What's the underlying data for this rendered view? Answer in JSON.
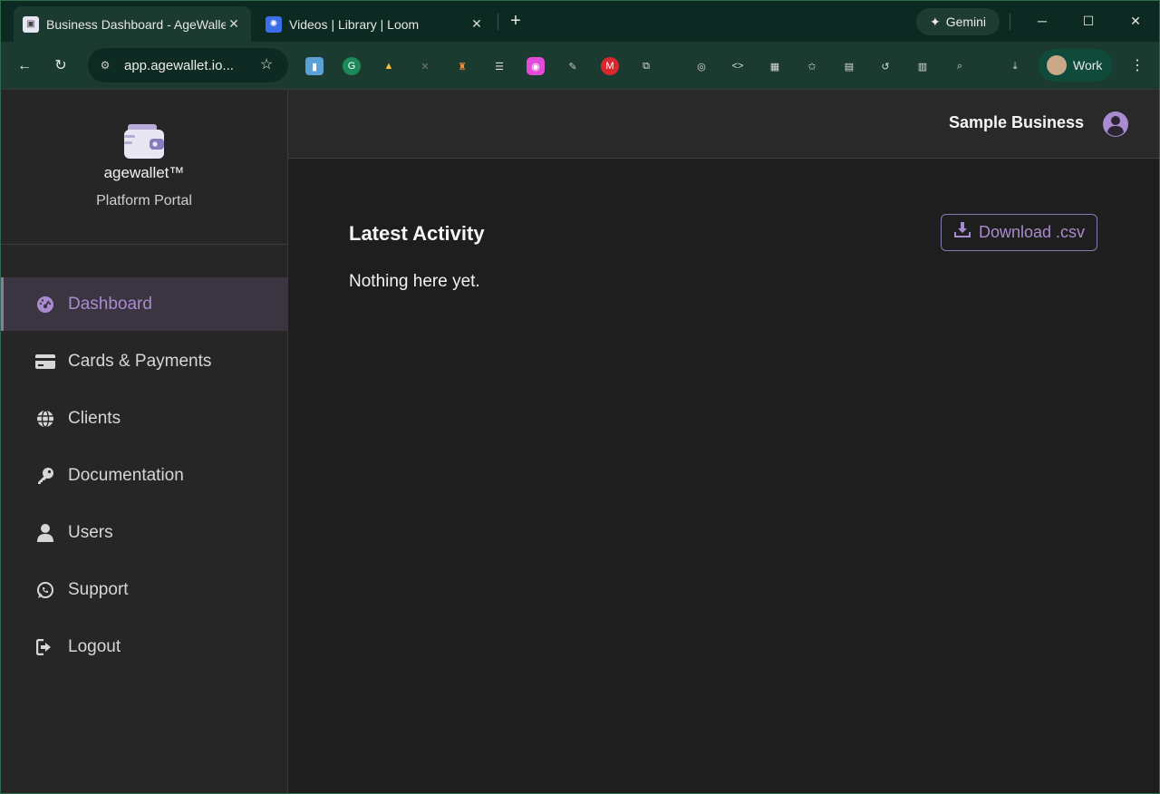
{
  "browser": {
    "tabs": [
      {
        "title": "Business Dashboard - AgeWallet",
        "active": true
      },
      {
        "title": "Videos | Library | Loom",
        "active": false
      }
    ],
    "gemini_label": "Gemini",
    "url": "app.agewallet.io...",
    "profile_label": "Work"
  },
  "sidebar": {
    "brand_name": "agewallet™",
    "brand_subtitle": "Platform Portal",
    "items": [
      {
        "label": "Dashboard",
        "icon": "dashboard-gauge-icon",
        "active": true
      },
      {
        "label": "Cards & Payments",
        "icon": "credit-card-icon",
        "active": false
      },
      {
        "label": "Clients",
        "icon": "globe-icon",
        "active": false
      },
      {
        "label": "Documentation",
        "icon": "key-icon",
        "active": false
      },
      {
        "label": "Users",
        "icon": "user-icon",
        "active": false
      },
      {
        "label": "Support",
        "icon": "whatsapp-icon",
        "active": false
      },
      {
        "label": "Logout",
        "icon": "logout-icon",
        "active": false
      }
    ]
  },
  "header": {
    "business_name": "Sample Business"
  },
  "main": {
    "section_title": "Latest Activity",
    "download_label": "Download .csv",
    "empty_message": "Nothing here yet."
  },
  "colors": {
    "accent": "#a98ccf",
    "sidebar_bg": "#262626",
    "main_bg": "#1e1e1e",
    "browser_frame": "#1b3a30"
  }
}
